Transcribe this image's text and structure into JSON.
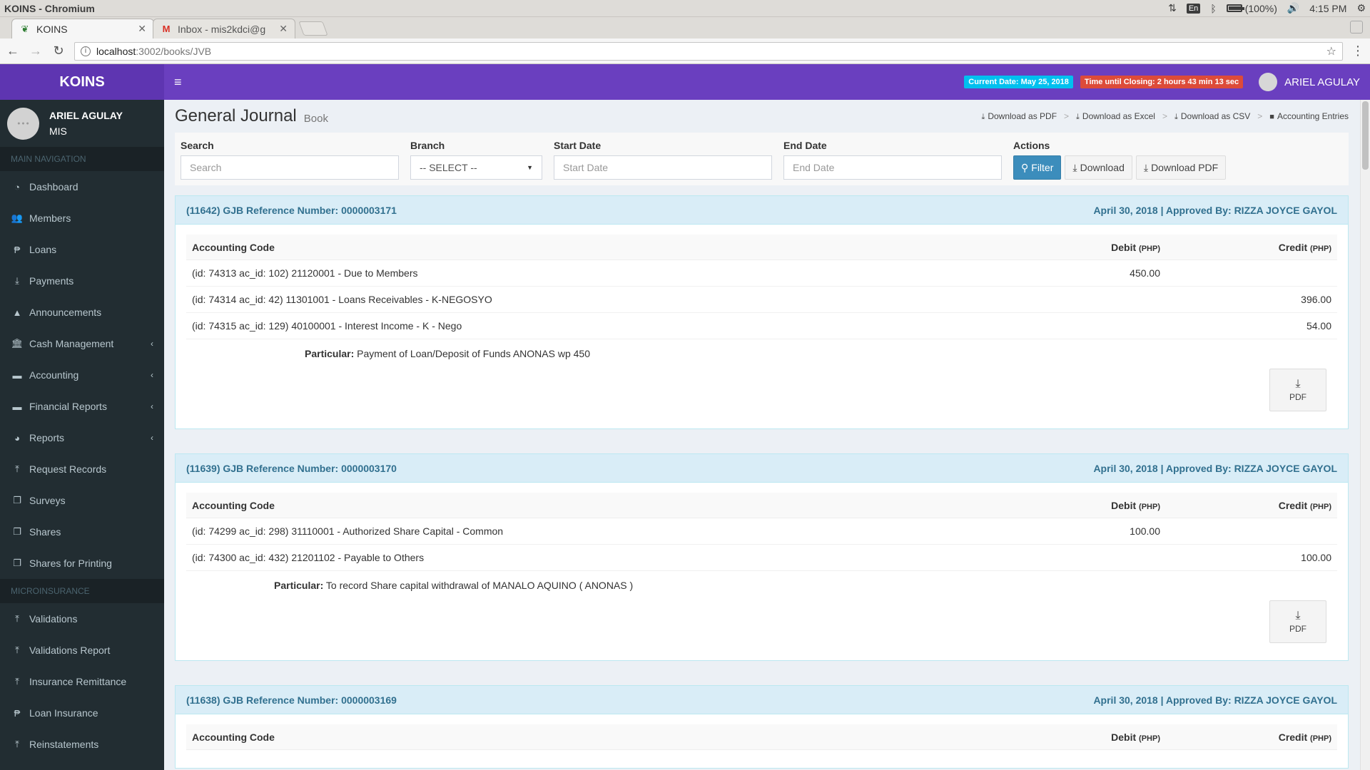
{
  "os": {
    "window_title": "KOINS - Chromium",
    "lang": "En",
    "battery": "(100%)",
    "battery_level": 1.0,
    "time": "4:15 PM"
  },
  "browser": {
    "tabs": [
      {
        "label": "KOINS",
        "icon": "koins-leaf-icon",
        "active": true
      },
      {
        "label": "Inbox - mis2kdci@g",
        "icon": "gmail-icon",
        "active": false
      }
    ],
    "url_host": "localhost",
    "url_path": ":3002/books/JVB"
  },
  "app": {
    "brand": "KOINS",
    "current_date_label": "Current Date: May 25, 2018",
    "closing_label": "Time until Closing: 2 hours 43 min 13 sec",
    "user_name": "ARIEL AGULAY",
    "user_role": "MIS",
    "colors": {
      "brand": "#5e35b1",
      "topbar": "#6a3fbf",
      "sidebar": "#222d32",
      "accent": "#3c8dbc",
      "info": "#00c0ef",
      "danger": "#dd4b39"
    }
  },
  "sidebar": {
    "main_header": "MAIN NAVIGATION",
    "main_items": [
      {
        "label": "Dashboard",
        "icon": "dashboard-icon",
        "glyph": "◔",
        "has_children": false
      },
      {
        "label": "Members",
        "icon": "users-icon",
        "glyph": "👥",
        "has_children": false
      },
      {
        "label": "Loans",
        "icon": "peso-icon",
        "glyph": "₱",
        "has_children": false
      },
      {
        "label": "Payments",
        "icon": "download-icon",
        "glyph": "⤓",
        "has_children": false
      },
      {
        "label": "Announcements",
        "icon": "warning-icon",
        "glyph": "▲",
        "has_children": false
      },
      {
        "label": "Cash Management",
        "icon": "bank-icon",
        "glyph": "🏛",
        "has_children": true
      },
      {
        "label": "Accounting",
        "icon": "credit-card-icon",
        "glyph": "▬",
        "has_children": true
      },
      {
        "label": "Financial Reports",
        "icon": "credit-card-icon",
        "glyph": "▬",
        "has_children": true
      },
      {
        "label": "Reports",
        "icon": "pie-chart-icon",
        "glyph": "◕",
        "has_children": true
      },
      {
        "label": "Request Records",
        "icon": "upload-icon",
        "glyph": "⤒",
        "has_children": false
      },
      {
        "label": "Surveys",
        "icon": "copy-icon",
        "glyph": "❐",
        "has_children": false
      },
      {
        "label": "Shares",
        "icon": "copy-icon",
        "glyph": "❐",
        "has_children": false
      },
      {
        "label": "Shares for Printing",
        "icon": "copy-icon",
        "glyph": "❐",
        "has_children": false
      }
    ],
    "micro_header": "MICROINSURANCE",
    "micro_items": [
      {
        "label": "Validations",
        "icon": "upload-icon",
        "glyph": "⤒"
      },
      {
        "label": "Validations Report",
        "icon": "upload-icon",
        "glyph": "⤒"
      },
      {
        "label": "Insurance Remittance",
        "icon": "upload-icon",
        "glyph": "⤒"
      },
      {
        "label": "Loan Insurance",
        "icon": "peso-icon",
        "glyph": "₱"
      },
      {
        "label": "Reinstatements",
        "icon": "upload-icon",
        "glyph": "⤒"
      }
    ]
  },
  "page": {
    "title": "General Journal",
    "subtitle": "Book",
    "crumbs": [
      "Download as PDF",
      "Download as Excel",
      "Download as CSV",
      "Accounting Entries"
    ]
  },
  "filters": {
    "search_label": "Search",
    "search_placeholder": "Search",
    "branch_label": "Branch",
    "branch_value": "-- SELECT --",
    "start_label": "Start Date",
    "start_placeholder": "Start Date",
    "end_label": "End Date",
    "end_placeholder": "End Date",
    "actions_label": "Actions",
    "filter_btn": "Filter",
    "download_btn": "Download",
    "download_pdf_btn": "Download PDF"
  },
  "table_headers": {
    "code": "Accounting Code",
    "debit": "Debit",
    "credit": "Credit",
    "unit": "(PHP)"
  },
  "entries": [
    {
      "ref": "(11642) GJB Reference Number: 0000003171",
      "meta": "April 30, 2018 | Approved By: RIZZA JOYCE GAYOL",
      "rows": [
        {
          "code": "(id: 74313 ac_id: 102) 21120001 - Due to Members",
          "debit": "450.00",
          "credit": ""
        },
        {
          "code": "(id: 74314 ac_id: 42) 11301001 - Loans Receivables - K-NEGOSYO",
          "debit": "",
          "credit": "396.00"
        },
        {
          "code": "(id: 74315 ac_id: 129) 40100001 - Interest Income - K - Nego",
          "debit": "",
          "credit": "54.00"
        }
      ],
      "particular_label": "Particular:",
      "particular": "Payment of Loan/Deposit of Funds ANONAS wp 450",
      "pdf": "PDF"
    },
    {
      "ref": "(11639) GJB Reference Number: 0000003170",
      "meta": "April 30, 2018 | Approved By: RIZZA JOYCE GAYOL",
      "rows": [
        {
          "code": "(id: 74299 ac_id: 298) 31110001 - Authorized Share Capital - Common",
          "debit": "100.00",
          "credit": ""
        },
        {
          "code": "(id: 74300 ac_id: 432) 21201102 - Payable to Others",
          "debit": "",
          "credit": "100.00"
        }
      ],
      "particular_label": "Particular:",
      "particular": "To record Share capital withdrawal of MANALO AQUINO ( ANONAS )",
      "pdf": "PDF"
    },
    {
      "ref": "(11638) GJB Reference Number: 0000003169",
      "meta": "April 30, 2018 | Approved By: RIZZA JOYCE GAYOL",
      "rows": [],
      "particular_label": "",
      "particular": "",
      "pdf": ""
    }
  ]
}
